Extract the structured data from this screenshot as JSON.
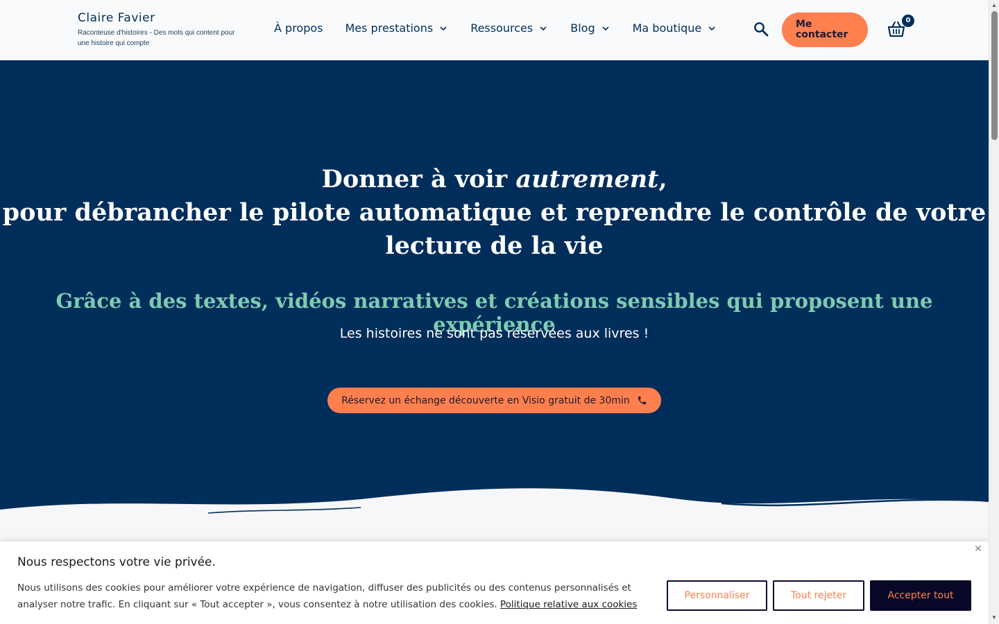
{
  "header": {
    "brand_name": "Claire Favier",
    "brand_tagline": "Raconteuse d'histoires - Des mots qui content pour une histoire qui compte",
    "nav": [
      {
        "label": "À propos",
        "has_dropdown": false
      },
      {
        "label": "Mes prestations",
        "has_dropdown": true
      },
      {
        "label": "Ressources",
        "has_dropdown": true
      },
      {
        "label": "Blog",
        "has_dropdown": true
      },
      {
        "label": "Ma boutique",
        "has_dropdown": true
      }
    ],
    "search_icon": "search-icon",
    "contact_label": "Me contacter",
    "cart_icon": "basket-icon",
    "cart_count": "0"
  },
  "hero": {
    "title_pre": "Donner à voir ",
    "title_em": "autrement",
    "title_post": ",",
    "title_line2": "pour débrancher le pilote automatique et reprendre le contrôle de votre lecture de la vie",
    "subtitle": "Grâce à des textes, vidéos narratives et créations sensibles qui proposent une expérience",
    "tagline": "Les histoires ne sont pas réservées aux livres !",
    "cta_label": "Réservez un échange découverte en Visio gratuit de 30min",
    "cta_icon": "phone-icon"
  },
  "cookie": {
    "title": "Nous respectons votre vie privée.",
    "text": "Nous utilisons des cookies pour améliorer votre expérience de navigation, diffuser des publicités ou des contenus personnalisés et analyser notre trafic. En cliquant sur « Tout accepter », vous consentez à notre utilisation des cookies. ",
    "link": "Politique relative aux cookies",
    "customize": "Personnaliser",
    "reject": "Tout rejeter",
    "accept": "Accepter tout",
    "close_icon": "close-icon"
  },
  "colors": {
    "navy": "#002e5b",
    "accent": "#ff7f4f",
    "mint": "#7ecbb1",
    "header_bg": "#f9fafb"
  }
}
